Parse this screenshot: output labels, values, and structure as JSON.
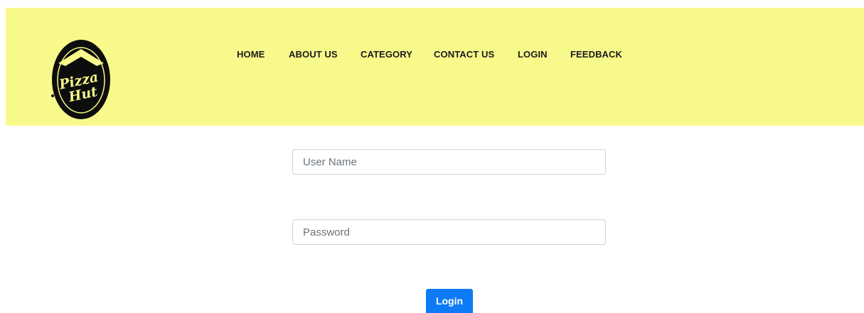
{
  "header": {
    "background_color": "#f8f98b",
    "logo": {
      "name": "pizza-hut-logo",
      "text_line1": "Pizza",
      "text_line2": "Hut"
    },
    "nav": {
      "home": "HOME",
      "about": "ABOUT US",
      "category": "CATEGORY",
      "contact": "CONTACT US",
      "login": "LOGIN",
      "feedback": "FEEDBACK"
    }
  },
  "form": {
    "username": {
      "placeholder": "User Name",
      "value": ""
    },
    "password": {
      "placeholder": "Password",
      "value": ""
    },
    "submit_label": "Login",
    "accent_color": "#0d7bf5"
  }
}
